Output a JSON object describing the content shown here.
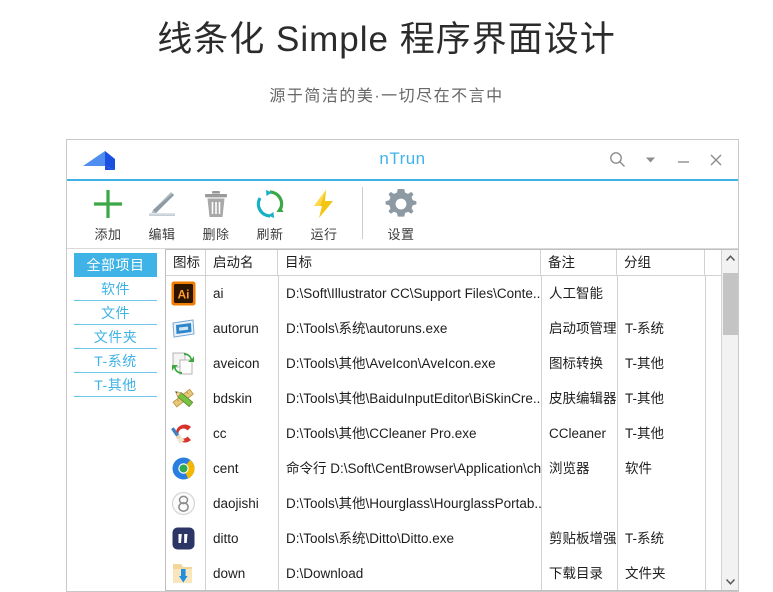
{
  "page": {
    "title": "线条化 Simple 程序界面设计",
    "subtitle": "源于简洁的美·一切尽在不言中"
  },
  "window": {
    "app_title": "nTrun",
    "accent_color": "#3fb3e6",
    "controls": [
      {
        "name": "search-icon",
        "label": "搜索"
      },
      {
        "name": "chevron-down-icon",
        "label": "菜单"
      },
      {
        "name": "minimize-icon",
        "label": "最小化"
      },
      {
        "name": "close-icon",
        "label": "关闭"
      }
    ]
  },
  "toolbar": {
    "items": [
      {
        "label": "添加",
        "icon": "plus-icon",
        "color": "#39a845"
      },
      {
        "label": "编辑",
        "icon": "pencil-icon",
        "color": "#8d9aa3"
      },
      {
        "label": "删除",
        "icon": "trash-icon",
        "color": "#9a9a9a"
      },
      {
        "label": "刷新",
        "icon": "refresh-icon",
        "color": "#18b0c4"
      },
      {
        "label": "运行",
        "icon": "lightning-icon",
        "color": "#f5c513"
      }
    ],
    "settings": {
      "label": "设置",
      "icon": "gear-icon",
      "color": "#8d9aa3"
    }
  },
  "sidebar": {
    "items": [
      {
        "label": "全部项目",
        "selected": true
      },
      {
        "label": "软件",
        "selected": false
      },
      {
        "label": "文件",
        "selected": false
      },
      {
        "label": "文件夹",
        "selected": false
      },
      {
        "label": "T-系统",
        "selected": false
      },
      {
        "label": "T-其他",
        "selected": false
      }
    ]
  },
  "table": {
    "headers": {
      "icon": "图标",
      "name": "启动名",
      "target": "目标",
      "note": "备注",
      "group": "分组",
      "pad": ""
    },
    "rows": [
      {
        "icon": "illustrator-icon",
        "name": "ai",
        "target": "D:\\Soft\\Illustrator CC\\Support Files\\Conte...",
        "note": "人工智能",
        "group": ""
      },
      {
        "icon": "autoruns-icon",
        "name": "autorun",
        "target": "D:\\Tools\\系统\\autoruns.exe",
        "note": "启动项管理",
        "group": "T-系统"
      },
      {
        "icon": "aveicon-icon",
        "name": "aveicon",
        "target": "D:\\Tools\\其他\\AveIcon\\AveIcon.exe",
        "note": "图标转换",
        "group": "T-其他"
      },
      {
        "icon": "bdskin-icon",
        "name": "bdskin",
        "target": "D:\\Tools\\其他\\BaiduInputEditor\\BiSkinCre...",
        "note": "皮肤编辑器",
        "group": "T-其他"
      },
      {
        "icon": "ccleaner-icon",
        "name": "cc",
        "target": "D:\\Tools\\其他\\CCleaner Pro.exe",
        "note": "CCleaner",
        "group": "T-其他"
      },
      {
        "icon": "centbrowser-icon",
        "name": "cent",
        "target": "命令行 D:\\Soft\\CentBrowser\\Application\\ch...",
        "note": "浏览器",
        "group": "软件"
      },
      {
        "icon": "hourglass-icon",
        "name": "daojishi",
        "target": "D:\\Tools\\其他\\Hourglass\\HourglassPortab...",
        "note": "",
        "group": ""
      },
      {
        "icon": "ditto-icon",
        "name": "ditto",
        "target": "D:\\Tools\\系统\\Ditto\\Ditto.exe",
        "note": "剪贴板增强",
        "group": "T-系统"
      },
      {
        "icon": "download-icon",
        "name": "down",
        "target": "D:\\Download",
        "note": "下载目录",
        "group": "文件夹"
      }
    ],
    "scrollbar": {
      "up_icon": "chevron-up-icon",
      "down_icon": "chevron-down-icon"
    }
  }
}
